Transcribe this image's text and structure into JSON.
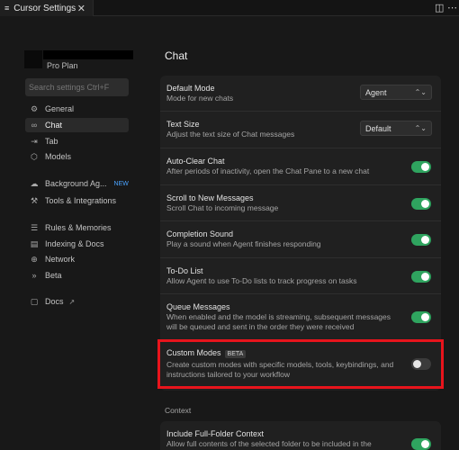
{
  "tabbar": {
    "tab_label": "Cursor Settings",
    "tab_icon": "≡",
    "close_glyph": "✕",
    "split_glyph": "◫",
    "more_glyph": "⋯"
  },
  "sidebar": {
    "plan": "Pro Plan",
    "search_placeholder": "Search settings Ctrl+F",
    "items": [
      {
        "label": "General",
        "icon": "⚙"
      },
      {
        "label": "Chat",
        "icon": "∞"
      },
      {
        "label": "Tab",
        "icon": "⇥"
      },
      {
        "label": "Models",
        "icon": "⬡"
      },
      {
        "label": "Background Ag...",
        "icon": "☁",
        "badge": "NEW"
      },
      {
        "label": "Tools & Integrations",
        "icon": "⚒"
      },
      {
        "label": "Rules & Memories",
        "icon": "☰"
      },
      {
        "label": "Indexing & Docs",
        "icon": "▤"
      },
      {
        "label": "Network",
        "icon": "⊕"
      },
      {
        "label": "Beta",
        "icon": "»"
      },
      {
        "label": "Docs",
        "icon": "▢",
        "ext": "↗"
      }
    ]
  },
  "main": {
    "title": "Chat",
    "settings": [
      {
        "title": "Default Mode",
        "desc": "Mode for new chats",
        "value": "Agent"
      },
      {
        "title": "Text Size",
        "desc": "Adjust the text size of Chat messages",
        "value": "Default"
      },
      {
        "title": "Auto-Clear Chat",
        "desc": "After periods of inactivity, open the Chat Pane to a new chat",
        "enabled": true
      },
      {
        "title": "Scroll to New Messages",
        "desc": "Scroll Chat to incoming message",
        "enabled": true
      },
      {
        "title": "Completion Sound",
        "desc": "Play a sound when Agent finishes responding",
        "enabled": true
      },
      {
        "title": "To-Do List",
        "desc": "Allow Agent to use To-Do lists to track progress on tasks",
        "enabled": true
      },
      {
        "title": "Queue Messages",
        "desc": "When enabled and the model is streaming, subsequent messages will be queued and sent in the order they were received",
        "enabled": true
      },
      {
        "title": "Custom Modes",
        "badge": "BETA",
        "desc": "Create custom modes with specific models, tools, keybindings, and instructions tailored to your workflow",
        "enabled": false
      }
    ],
    "context_label": "Context",
    "context_settings": [
      {
        "title": "Include Full-Folder Context",
        "desc": "Allow full contents of the selected folder to be included in the",
        "enabled": true
      }
    ]
  },
  "colors": {
    "toggle_on": "#2fa45f",
    "highlight": "#e8141c",
    "new_badge": "#4aa3ff"
  }
}
